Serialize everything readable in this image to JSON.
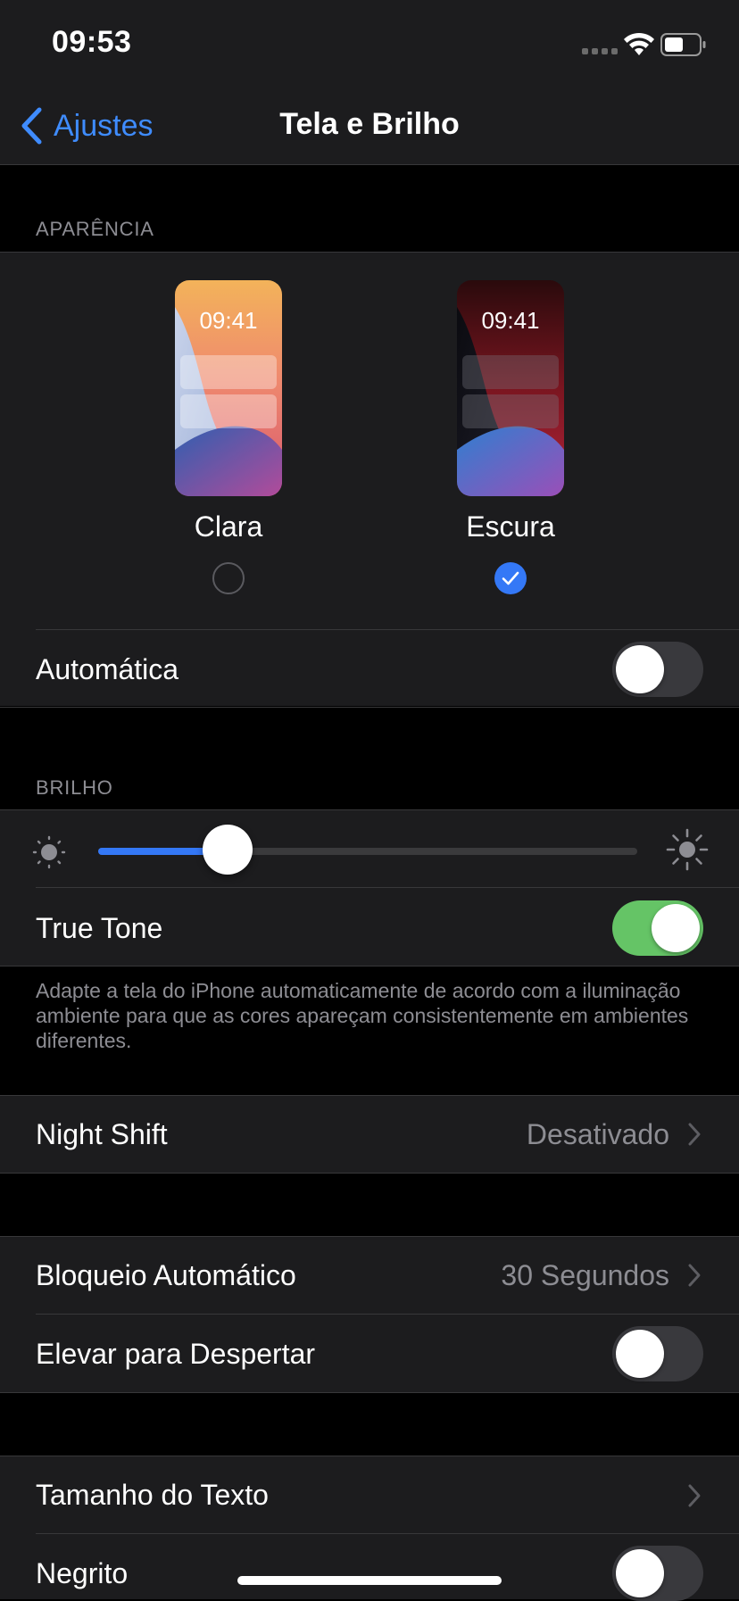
{
  "status_bar": {
    "time": "09:53"
  },
  "nav": {
    "back_label": "Ajustes",
    "title": "Tela e Brilho"
  },
  "appearance": {
    "header": "APARÊNCIA",
    "preview_time": "09:41",
    "options": [
      {
        "label": "Clara",
        "selected": false
      },
      {
        "label": "Escura",
        "selected": true
      }
    ],
    "automatic": {
      "label": "Automática",
      "on": false
    }
  },
  "brightness": {
    "header": "BRILHO",
    "level": 0.24,
    "true_tone": {
      "label": "True Tone",
      "on": true
    },
    "footer": "Adapte a tela do iPhone automaticamente de acordo com a iluminação ambiente para que as cores apareçam consistentemente em ambientes diferentes."
  },
  "night_shift": {
    "label": "Night Shift",
    "value": "Desativado"
  },
  "lock": {
    "auto_lock": {
      "label": "Bloqueio Automático",
      "value": "30 Segundos"
    },
    "raise_to_wake": {
      "label": "Elevar para Despertar",
      "on": false
    }
  },
  "text": {
    "text_size": {
      "label": "Tamanho do Texto"
    },
    "bold": {
      "label": "Negrito",
      "on": false
    }
  },
  "colors": {
    "accent": "#3478f6",
    "toggle_on": "#65c466",
    "toggle_off": "#39393d",
    "cell_bg": "#1c1c1e",
    "page_bg": "#000000",
    "secondary_text": "#8d8d93"
  }
}
